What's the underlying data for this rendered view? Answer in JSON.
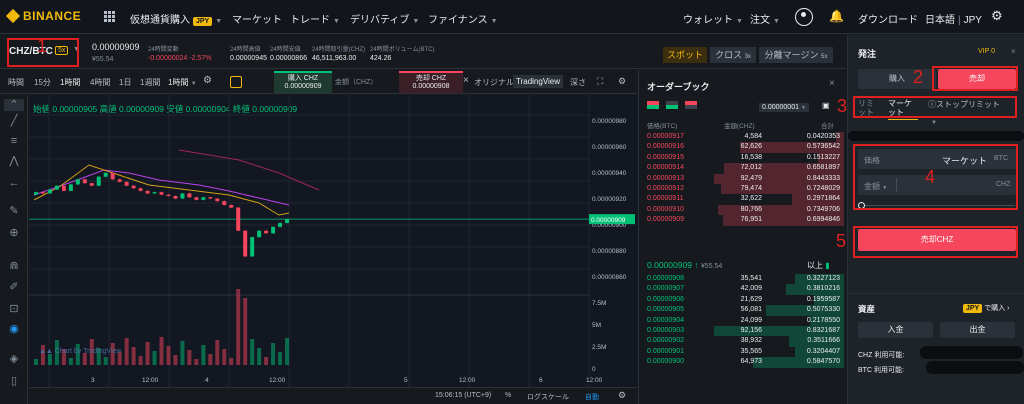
{
  "nav": {
    "logo": "BINANCE",
    "items": [
      "仮想通貨購入",
      "マーケット",
      "トレード",
      "デリバティブ",
      "ファイナンス"
    ],
    "jpy_badge": "JPY",
    "right": [
      "ウォレット",
      "注文",
      "ダウンロード",
      "日本語",
      "JPY"
    ]
  },
  "ticker": {
    "pair": "CHZ/BTC",
    "leverage": "5x",
    "price": "0.00000909",
    "price_jpy": "¥55.54",
    "change_label": "24時間変動",
    "change_value": "-0.00000024 -2.57%",
    "high_label": "24時間高値",
    "high_value": "0.00000945",
    "low_label": "24時間安値",
    "low_value": "0.00000866",
    "vol_chz_label": "24時間取引量(CHZ)",
    "vol_chz_value": "46,511,963.00",
    "vol_btc_label": "24時間ボリューム(BTC)",
    "vol_btc_value": "424.26",
    "tabs": [
      "スポット",
      "クロス",
      "分離マージン"
    ],
    "tab_suffix": [
      "",
      "3x",
      "5x"
    ]
  },
  "charttabs": {
    "time_label": "時間",
    "intervals": [
      "15分",
      "1時間",
      "4時間",
      "1日",
      "1週間"
    ],
    "interval_select": "1時間",
    "buy_label": "購入 CHZ",
    "buy_price": "0.00000909",
    "amount_label": "金額（CHZ）",
    "sell_label": "売却 CHZ",
    "sell_price": "0.00000908",
    "original": "オリジナル",
    "tradingview": "TradingView",
    "depth": "深さ"
  },
  "chart": {
    "ohlc_text": "始値 0.00000905 高値 0.00000909 安値 0.00000904 終値 0.00000909",
    "price_axis": [
      "0.00000980",
      "0.00000960",
      "0.00000940",
      "0.00000920",
      "0.00000900",
      "0.00000880",
      "0.00000860"
    ],
    "current_price_tag": "0.00000909",
    "vol_axis": [
      "7.5M",
      "5M",
      "2.5M",
      "0"
    ],
    "time_axis": [
      "3",
      "12:00",
      "4",
      "12:00",
      "5",
      "12:00",
      "6",
      "12:00"
    ],
    "watermark": "Chart by TradingView",
    "footer_time": "15:06:15 (UTC+9)",
    "footer_items": [
      "%",
      "ログスケール",
      "自動"
    ],
    "up_color": "#02c076",
    "down_color": "#f6465d"
  },
  "chart_data": {
    "type": "candlestick",
    "ylim": [
      8.5e-06,
      9.9e-06
    ],
    "candles_close": [
      9.3e-06,
      9.29e-06,
      9.32e-06,
      9.35e-06,
      9.31e-06,
      9.36e-06,
      9.4e-06,
      9.37e-06,
      9.35e-06,
      9.42e-06,
      9.45e-06,
      9.4e-06,
      9.38e-06,
      9.35e-06,
      9.33e-06,
      9.31e-06,
      9.29e-06,
      9.3e-06,
      9.28e-06,
      9.27e-06,
      9.25e-06,
      9.29e-06,
      9.26e-06,
      9.24e-06,
      9.26e-06,
      9.25e-06,
      9.23e-06,
      9.2e-06,
      9.18e-06,
      9e-06,
      8.8e-06,
      8.95e-06,
      9e-06,
      8.98e-06,
      9.03e-06,
      9.06e-06,
      9.09e-06
    ]
  },
  "orderbook": {
    "title": "オーダーブック",
    "precision": "0.00000001",
    "headers": [
      "価格(BTC)",
      "金額(CHZ)",
      "合計"
    ],
    "asks": [
      [
        "0.00000917",
        "4,584",
        "0.0420353"
      ],
      [
        "0.00000916",
        "62,626",
        "0.5736542"
      ],
      [
        "0.00000915",
        "16,538",
        "0.1513227"
      ],
      [
        "0.00000914",
        "72,012",
        "0.6581897"
      ],
      [
        "0.00000913",
        "92,479",
        "0.8443333"
      ],
      [
        "0.00000912",
        "79,474",
        "0.7248029"
      ],
      [
        "0.00000911",
        "32,622",
        "0.2971864"
      ],
      [
        "0.00000910",
        "80,766",
        "0.7349706"
      ],
      [
        "0.00000909",
        "76,951",
        "0.6994846"
      ]
    ],
    "ask_fill": [
      0.06,
      0.8,
      0.2,
      0.92,
      1.0,
      0.95,
      0.4,
      0.97,
      0.93
    ],
    "last_price": "0.00000909",
    "last_price_jpy": "¥55.54",
    "more": "以上",
    "bids": [
      [
        "0.00000908",
        "35,541",
        "0.3227123"
      ],
      [
        "0.00000907",
        "42,009",
        "0.3810216"
      ],
      [
        "0.00000906",
        "21,629",
        "0.1959587"
      ],
      [
        "0.00000905",
        "56,081",
        "0.5075330"
      ],
      [
        "0.00000904",
        "24,099",
        "0.2178550"
      ],
      [
        "0.00000903",
        "92,156",
        "0.8321687"
      ],
      [
        "0.00000902",
        "38,932",
        "0.3511666"
      ],
      [
        "0.00000901",
        "35,565",
        "0.3204407"
      ],
      [
        "0.00000900",
        "64,973",
        "0.5847570"
      ]
    ],
    "bid_fill": [
      0.38,
      0.45,
      0.23,
      0.6,
      0.26,
      1.0,
      0.42,
      0.38,
      0.7
    ]
  },
  "orderform": {
    "title": "発注",
    "vip": "VIP 0",
    "buy_label": "購入",
    "sell_label": "売却",
    "types": [
      "リミット",
      "マーケット",
      "ストップリミット"
    ],
    "price_label": "価格",
    "price_value": "マーケット",
    "price_unit": "BTC",
    "amount_label": "金額",
    "amount_unit": "CHZ",
    "submit": "売却CHZ",
    "assets_title": "資産",
    "assets_link": "で購入",
    "assets_jpy": "JPY",
    "deposit": "入金",
    "withdraw": "出金",
    "chz_avail": "CHZ 利用可能:",
    "btc_avail": "BTC 利用可能:"
  },
  "annotations": [
    "1",
    "2",
    "3",
    "4",
    "5"
  ],
  "colors": {
    "accent": "#f0b90b",
    "red": "#f6465d",
    "green": "#02c076",
    "annotation": "#e02020"
  }
}
